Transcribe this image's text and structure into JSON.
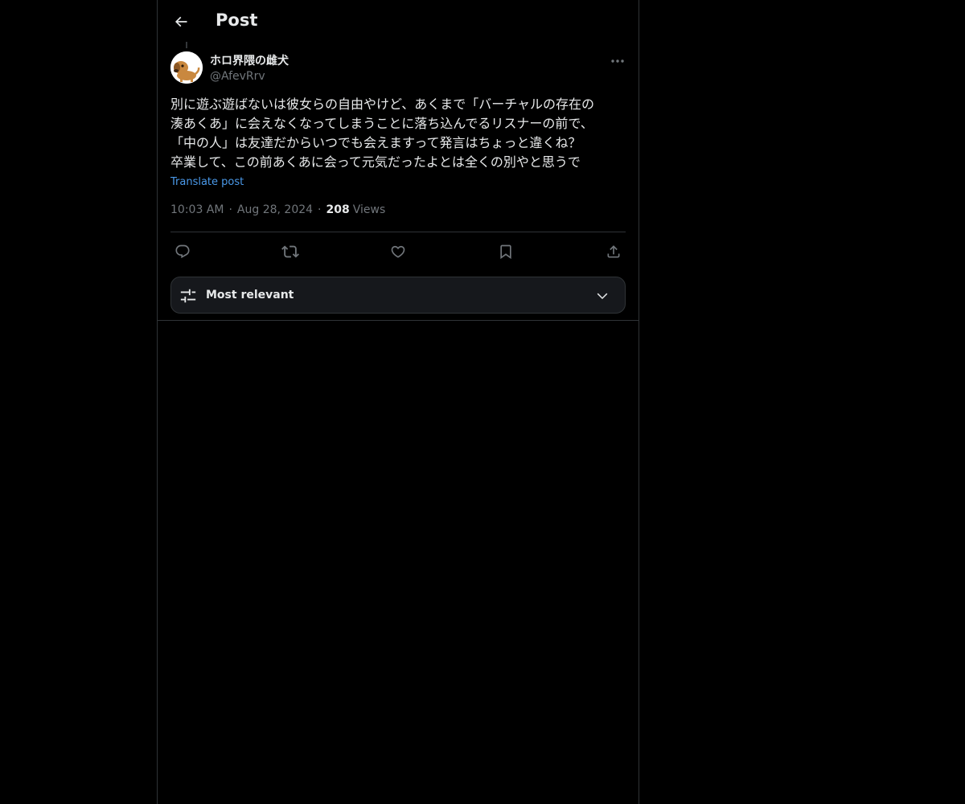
{
  "header": {
    "title": "Post"
  },
  "post": {
    "author_name": "ホロ界隈の雌犬",
    "author_handle": "@AfevRrv",
    "text_lines": [
      "別に遊ぶ遊ばないは彼女らの自由やけど、あくまで「バーチャルの存在の",
      "湊あくあ」に会えなくなってしまうことに落ち込んでるリスナーの前で、",
      "「中の人」は友達だからいつでも会えますって発言はちょっと違くね？",
      "卒業して、この前あくあに会って元気だったよとは全くの別やと思うで"
    ],
    "translate_label": "Translate post",
    "time": "10:03 AM",
    "date": "Aug 28, 2024",
    "separator": "·",
    "views_count": "208",
    "views_label": "Views"
  },
  "actions": {
    "reply_icon": "reply-icon",
    "repost_icon": "repost-icon",
    "like_icon": "heart-icon",
    "bookmark_icon": "bookmark-icon",
    "share_icon": "share-icon"
  },
  "replies_sort": {
    "selected": "Most relevant"
  },
  "colors": {
    "background": "#000000",
    "text": "#e7e9ea",
    "muted": "#71767b",
    "link": "#4a99e9",
    "border": "#2f3336",
    "sort_box_bg": "#16181c"
  }
}
